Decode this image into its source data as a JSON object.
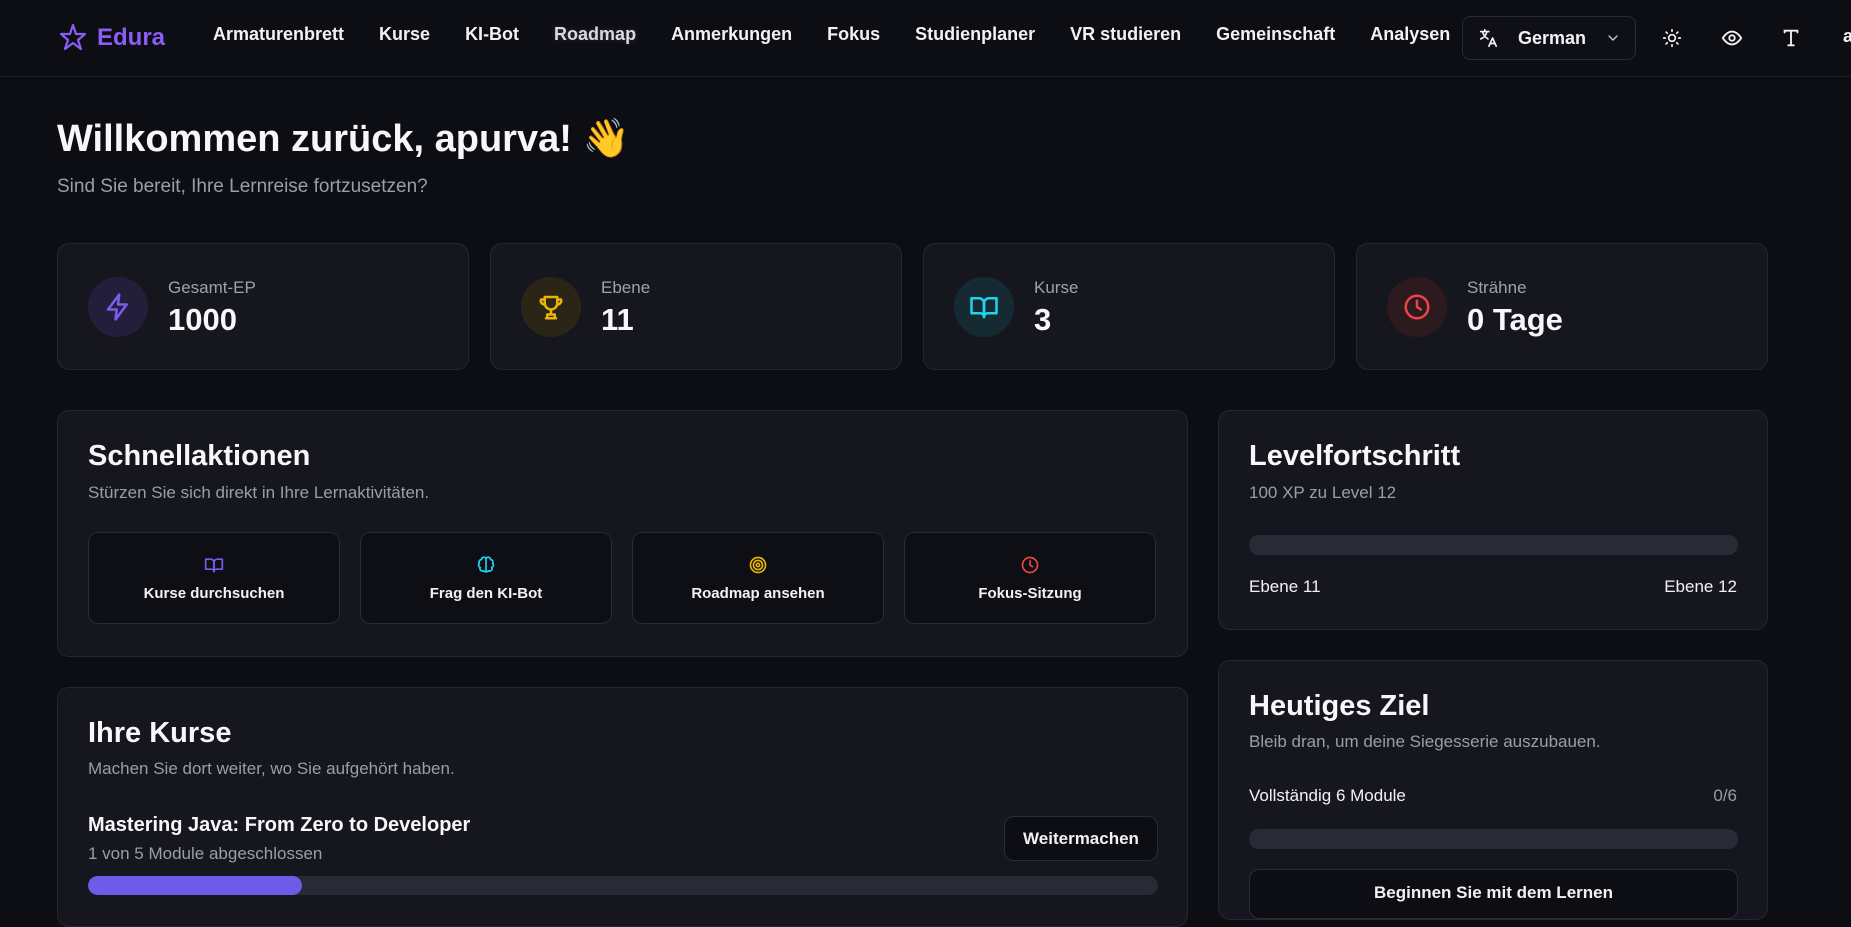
{
  "brand": {
    "name": "Edura"
  },
  "nav": {
    "links": [
      "Armaturenbrett",
      "Kurse",
      "KI-Bot",
      "Roadmap",
      "Anmerkungen",
      "Fokus",
      "Studienplaner",
      "VR studieren",
      "Gemeinschaft",
      "Analysen"
    ],
    "active": "Roadmap",
    "language": "German",
    "cut_text": "a"
  },
  "header": {
    "title": "Willkommen zurück, apurva! 👋",
    "subtitle": "Sind Sie bereit, Ihre Lernreise fortzusetzen?"
  },
  "stats": [
    {
      "label": "Gesamt-EP",
      "value": "1000",
      "icon": "lightning-icon",
      "color": "#7c5cf0",
      "bg": "#231f3a"
    },
    {
      "label": "Ebene",
      "value": "11",
      "icon": "trophy-icon",
      "color": "#eab308",
      "bg": "#2b2517"
    },
    {
      "label": "Kurse",
      "value": "3",
      "icon": "book-open-icon",
      "color": "#22d3ee",
      "bg": "#162a33"
    },
    {
      "label": "Strähne",
      "value": "0 Tage",
      "icon": "clock-icon",
      "color": "#ef4444",
      "bg": "#2c1a1f"
    }
  ],
  "quick_actions": {
    "title": "Schnellaktionen",
    "subtitle": "Stürzen Sie sich direkt in Ihre Lernaktivitäten.",
    "items": [
      {
        "label": "Kurse durchsuchen",
        "icon": "book-open-icon",
        "color": "#7c5cf0"
      },
      {
        "label": "Frag den KI-Bot",
        "icon": "brain-icon",
        "color": "#22d3ee"
      },
      {
        "label": "Roadmap ansehen",
        "icon": "target-icon",
        "color": "#eab308"
      },
      {
        "label": "Fokus-Sitzung",
        "icon": "clock-icon",
        "color": "#ef4444"
      }
    ]
  },
  "level_progress": {
    "title": "Levelfortschritt",
    "subtitle": "100 XP zu Level 12",
    "current": "Ebene 11",
    "next": "Ebene 12",
    "progress": 0
  },
  "courses": {
    "title": "Ihre Kurse",
    "subtitle": "Machen Sie dort weiter, wo Sie aufgehört haben.",
    "items": [
      {
        "name": "Mastering Java: From Zero to Developer",
        "status": "1 von 5 Module abgeschlossen",
        "progress": 0.2,
        "button": "Weitermachen"
      }
    ]
  },
  "goal": {
    "title": "Heutiges Ziel",
    "subtitle": "Bleib dran, um deine Siegesserie auszubauen.",
    "task": "Vollständig 6 Module",
    "count": "0/6",
    "progress": 0,
    "button": "Beginnen Sie mit dem Lernen"
  },
  "colors": {
    "accent": "#6d5ce8",
    "brand": "#8b5cf6"
  }
}
